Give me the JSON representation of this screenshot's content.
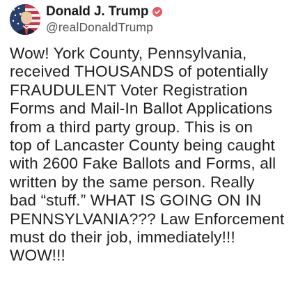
{
  "author": {
    "display_name": "Donald J. Trump",
    "handle": "@realDonaldTrump",
    "avatar_icon": "profile-photo-avatar",
    "verified_icon": "verified-badge-icon",
    "verified_color": "#e8585f"
  },
  "post": {
    "lines": [
      "Wow! York County, Pennsylvania,",
      "received THOUSANDS of potentially",
      "FRAUDULENT Voter Registration",
      "Forms and Mail-In Ballot Applications",
      "from a third party group. This is on",
      "top of Lancaster County being caught",
      "with 2600 Fake Ballots and Forms, all",
      "written by the same person. Really",
      "bad “stuff.” WHAT IS GOING ON IN",
      "PENNSYLVANIA??? Law Enforcement",
      "must do their job, immediately!!!",
      "WOW!!!"
    ]
  }
}
